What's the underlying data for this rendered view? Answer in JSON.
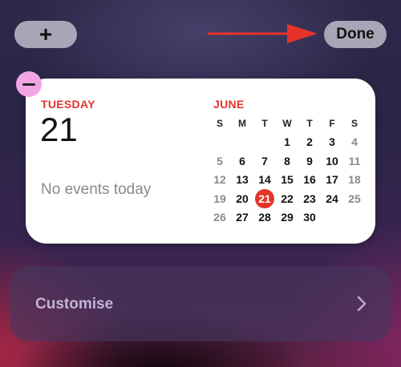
{
  "topbar": {
    "add_label": "+",
    "done_label": "Done"
  },
  "colors": {
    "accent_red": "#e5332a",
    "button_gray": "#a8a6b6",
    "remove_badge": "#f1a5e3"
  },
  "widget": {
    "day_name": "TUESDAY",
    "day_number": "21",
    "events_text": "No events today",
    "month": "JUNE",
    "weekday_headers": [
      "S",
      "M",
      "T",
      "W",
      "T",
      "F",
      "S"
    ],
    "weeks": [
      [
        "",
        "",
        "",
        "1",
        "2",
        "3",
        "4"
      ],
      [
        "5",
        "6",
        "7",
        "8",
        "9",
        "10",
        "11"
      ],
      [
        "12",
        "13",
        "14",
        "15",
        "16",
        "17",
        "18"
      ],
      [
        "19",
        "20",
        "21",
        "22",
        "23",
        "24",
        "25"
      ],
      [
        "26",
        "27",
        "28",
        "29",
        "30",
        "",
        ""
      ]
    ],
    "today": "21"
  },
  "customise": {
    "label": "Customise"
  }
}
